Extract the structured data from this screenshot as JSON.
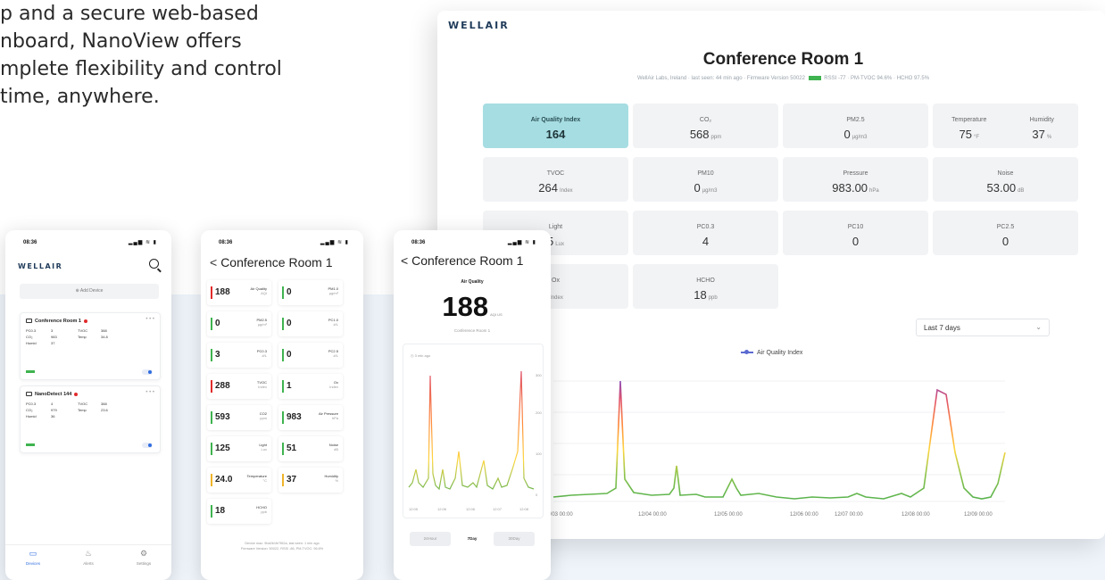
{
  "marketing": {
    "lines": [
      "p and a secure web-based",
      "nboard, NanoView offers",
      "mplete flexibility and control",
      "time, anywhere."
    ]
  },
  "colors": {
    "aqi_tile": "#a6dde2",
    "accent_blue": "#2f6de0",
    "good_green": "#3fb34f",
    "alert_red": "#e12b2b"
  },
  "desktop": {
    "logo": "WELLAIR",
    "title": "Conference Room 1",
    "subtitle_location": "WellAir Labs, Ireland",
    "subtitle_seen": "last seen: 44 min ago",
    "subtitle_firmware": "Firmware Version 50022",
    "subtitle_rssi": "RSSI -77",
    "subtitle_tvoc": "PM-TVOC 94.6%",
    "subtitle_hcho": "HCHO 97.5%",
    "tiles": {
      "aqi": {
        "label": "Air Quality Index",
        "value": "164",
        "unit": ""
      },
      "co2": {
        "label": "CO₂",
        "value": "568",
        "unit": "ppm"
      },
      "pm25": {
        "label": "PM2.5",
        "value": "0",
        "unit": "µg/m3"
      },
      "temp": {
        "label": "Temperature",
        "value": "75",
        "unit": "°F"
      },
      "hum": {
        "label": "Humidity",
        "value": "37",
        "unit": "%"
      },
      "tvoc": {
        "label": "TVOC",
        "value": "264",
        "unit": "Index"
      },
      "pm10": {
        "label": "PM10",
        "value": "0",
        "unit": "µg/m3"
      },
      "pressure": {
        "label": "Pressure",
        "value": "983.00",
        "unit": "hPa"
      },
      "noise": {
        "label": "Noise",
        "value": "53.00",
        "unit": "dB"
      },
      "light": {
        "label": "Light",
        "value": "5",
        "unit": "Lux"
      },
      "pc03": {
        "label": "PC0.3",
        "value": "4",
        "unit": ""
      },
      "pc10": {
        "label": "PC10",
        "value": "0",
        "unit": ""
      },
      "pc25": {
        "label": "PC2.5",
        "value": "0",
        "unit": ""
      },
      "ox": {
        "label": "Ox",
        "value": "",
        "unit": "Index"
      },
      "hcho": {
        "label": "HCHO",
        "value": "18",
        "unit": "ppb"
      }
    },
    "range_select": "Last 7 days",
    "chart_legend": "Air Quality Index",
    "x_ticks": [
      "12/03 00:00",
      "12/04 00:00",
      "12/05 00:00",
      "12/06 00:00",
      "12/07 00:00",
      "12/08 00:00",
      "12/09 00:00"
    ]
  },
  "phone1": {
    "time": "08:36",
    "status": "▂▄▆ ≋ ▮",
    "logo": "WELLAIR",
    "add_device": "⊕ Add Device",
    "devices": [
      {
        "name": "Conference Room 1",
        "more": "• • •",
        "pc": "PC0.3",
        "pc_val": "3",
        "tvoc": "TVOC",
        "tvoc_val": "388",
        "co2": "CO₂",
        "co2_val": "983",
        "temp": "Temp",
        "temp_val": "34.8",
        "hum": "Humid",
        "hum_val": "37"
      },
      {
        "name": "NanoDetect 144",
        "more": "• • •",
        "pc": "PC0.3",
        "pc_val": "4",
        "tvoc": "TVOC",
        "tvoc_val": "388",
        "co2": "CO₂",
        "co2_val": "979",
        "temp": "Temp",
        "temp_val": "23.6",
        "hum": "Humid",
        "hum_val": "36"
      }
    ],
    "tabs": {
      "devices": "Devices",
      "alerts": "Alerts",
      "settings": "Settings"
    }
  },
  "phone2": {
    "time": "08:36",
    "status": "▂▄▆ ≋ ▮",
    "title": "Conference Room 1",
    "readings": [
      {
        "value": "188",
        "label": "Air Quality",
        "unit": "AQI",
        "color": "#e12b2b"
      },
      {
        "value": "0",
        "label": "PM1.0",
        "unit": "µg/m³",
        "color": "#3fb34f"
      },
      {
        "value": "0",
        "label": "PM2.5",
        "unit": "µg/m³",
        "color": "#3fb34f"
      },
      {
        "value": "0",
        "label": "PC1.0",
        "unit": "#/L",
        "color": "#3fb34f"
      },
      {
        "value": "3",
        "label": "PC0.3",
        "unit": "#/L",
        "color": "#3fb34f"
      },
      {
        "value": "0",
        "label": "PC2.5",
        "unit": "#/L",
        "color": "#3fb34f"
      },
      {
        "value": "288",
        "label": "TVOC",
        "unit": "Index",
        "color": "#e12b2b"
      },
      {
        "value": "1",
        "label": "Ox",
        "unit": "Index",
        "color": "#3fb34f"
      },
      {
        "value": "593",
        "label": "CO2",
        "unit": "ppm",
        "color": "#3fb34f"
      },
      {
        "value": "983",
        "label": "Air Pressure",
        "unit": "hPa",
        "color": "#3fb34f"
      },
      {
        "value": "125",
        "label": "Light",
        "unit": "Lux",
        "color": "#3fb34f"
      },
      {
        "value": "51",
        "label": "Noise",
        "unit": "dB",
        "color": "#3fb34f"
      },
      {
        "value": "24.0",
        "label": "Temperature",
        "unit": "°C",
        "color": "#f0b429"
      },
      {
        "value": "37",
        "label": "Humidity",
        "unit": "%",
        "color": "#f0b429"
      },
      {
        "value": "18",
        "label": "HCHO",
        "unit": "ppb",
        "color": "#3fb34f"
      }
    ],
    "footer_1": "Device mac: 9ba0b1fe7f62a, last seen: 1 min ago",
    "footer_2": "Firmware Version: 50022, RSSI -86, PM-TVOC: 96.6%"
  },
  "phone3": {
    "time": "08:36",
    "status": "▂▄▆ ≋ ▮",
    "title": "Conference Room 1",
    "metric": "Air Quality",
    "value": "188",
    "unit": "AQI US",
    "room": "Conference Room 1",
    "updated": "◷ 3 min ago",
    "x_ticks": [
      "12:05",
      "12:06",
      "12:06",
      "12:07",
      "12:08"
    ],
    "y_ticks": [
      "300",
      "200",
      "100",
      "0"
    ],
    "segments": {
      "day": "24Hour",
      "week": "7Day",
      "month": "30Day"
    }
  }
}
